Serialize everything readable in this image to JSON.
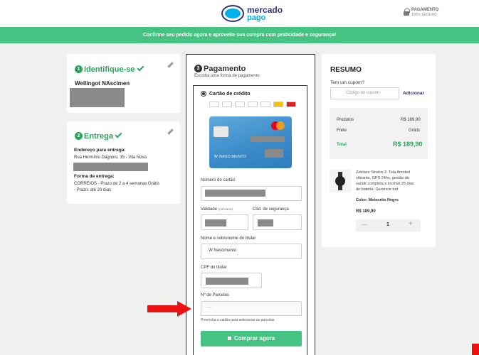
{
  "header": {
    "logo_line1": "mercado",
    "logo_line2": "pago",
    "secure_line1": "PAGAMENTO",
    "secure_line2": "100% SEGURO"
  },
  "banner_text": "Confirme seu pedido agora e aproveite sua compra com praticidade e segurança!",
  "identify": {
    "step": "1",
    "title": "Identifique-se",
    "name": "Wellingot NAscimen"
  },
  "delivery": {
    "step": "2",
    "title": "Entrega",
    "address_label": "Endereço para entrega:",
    "address": "Rua Hermínio Dagnoni, 35 - Vila Nova",
    "method_label": "Forma de entrega:",
    "method_line1": "CORREIOS - Prazo de 2 a 4 semanas Grátis",
    "method_line2": "- Prazo: até 20 dias"
  },
  "payment": {
    "step": "3",
    "title": "Pagamento",
    "subtitle": "Escolha uma forma de pagamento",
    "option_label": "Cartão de crédito",
    "card_holder_preview": "W NASCIMENTO",
    "card_number_label": "Número do cartão",
    "validity_label": "Validade",
    "validity_hint": "(mês/ano)",
    "cvv_label": "Cód. de segurança",
    "holder_label": "Nome e sobrenome do titular",
    "holder_value": "W Nascimento",
    "cpf_label": "CPF do titular",
    "installments_label": "Nº de Parcelas",
    "installments_value": "----",
    "installments_hint": "Preencha o cartão para selecionar as parcelas",
    "buy_label": "Comprar agora"
  },
  "summary": {
    "title": "RESUMO",
    "coupon_question": "Tem um cupom?",
    "coupon_placeholder": "Código do cupom",
    "coupon_button": "Adicionar",
    "products_label": "Produtos",
    "products_value": "R$ 189,90",
    "shipping_label": "Frete",
    "shipping_value": "Grátis",
    "total_label": "Total",
    "total_value": "R$ 189,90",
    "product_desc_1": "Zeblaze Stratos 2. Tela Amoled",
    "product_desc_2": "vibrante, GPS 24hs, gestão de",
    "product_desc_3": "saúde completa e incrível 25 dias",
    "product_desc_4": "de bateria. Gerencie tud",
    "product_color": "Color: Meteorito Negro",
    "product_price": "R$ 189,90",
    "qty_minus": "—",
    "qty_value": "1",
    "qty_plus": "+"
  },
  "colors": {
    "brand_green": "#44c382",
    "accent_blue": "#2d3277",
    "alert_red": "#ee1111"
  }
}
